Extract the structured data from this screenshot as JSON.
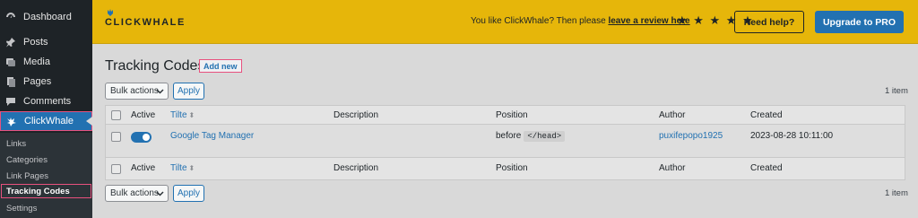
{
  "sidebar": {
    "items": [
      {
        "label": "Dashboard",
        "icon": "dashboard-icon"
      },
      {
        "label": "Posts",
        "icon": "pin-icon"
      },
      {
        "label": "Media",
        "icon": "media-icon"
      },
      {
        "label": "Pages",
        "icon": "pages-icon"
      },
      {
        "label": "Comments",
        "icon": "comment-icon"
      },
      {
        "label": "ClickWhale",
        "icon": "whale-icon",
        "active": true
      }
    ],
    "submenu": [
      "Links",
      "Categories",
      "Link Pages",
      "Tracking Codes",
      "Settings"
    ],
    "active_submenu": "Tracking Codes"
  },
  "header": {
    "logo_text": "CLICKWHALE",
    "review_prefix": "You like ClickWhale? Then please",
    "review_link": "leave a review here",
    "stars": "★ ★ ★ ★ ★",
    "help_label": "Need help?",
    "pro_label": "Upgrade to PRO"
  },
  "page": {
    "title": "Tracking Codes",
    "add_new": "Add new",
    "bulk_actions": "Bulk actions",
    "apply": "Apply",
    "item_count": "1 item"
  },
  "table": {
    "columns": {
      "active": "Active",
      "title": "Tilte",
      "description": "Description",
      "position": "Position",
      "author": "Author",
      "created": "Created"
    },
    "rows": [
      {
        "active": true,
        "title": "Google Tag Manager",
        "description": "",
        "position_prefix": "before",
        "position_code": "</head>",
        "author": "puxifepopo1925",
        "created": "2023-08-28 10:11:00"
      }
    ]
  },
  "colors": {
    "accent": "#2271b1",
    "header_bg": "#e6b60a",
    "sidebar_bg": "#1e2327",
    "highlight": "#e8517e"
  }
}
